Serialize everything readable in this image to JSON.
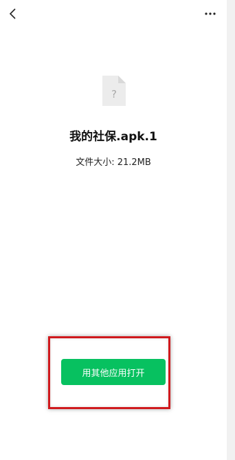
{
  "header": {
    "back_icon": "chevron-left-icon",
    "more_icon": "more-dots-icon"
  },
  "file": {
    "icon": "unknown-file-icon",
    "icon_glyph": "?",
    "name": "我的社保.apk.1",
    "size_text": "文件大小: 21.2MB"
  },
  "actions": {
    "open_with_other_app_label": "用其他应用打开"
  },
  "annotation": {
    "highlight_color": "#d0191d"
  },
  "colors": {
    "primary_button": "#07c160",
    "background": "#ffffff"
  }
}
